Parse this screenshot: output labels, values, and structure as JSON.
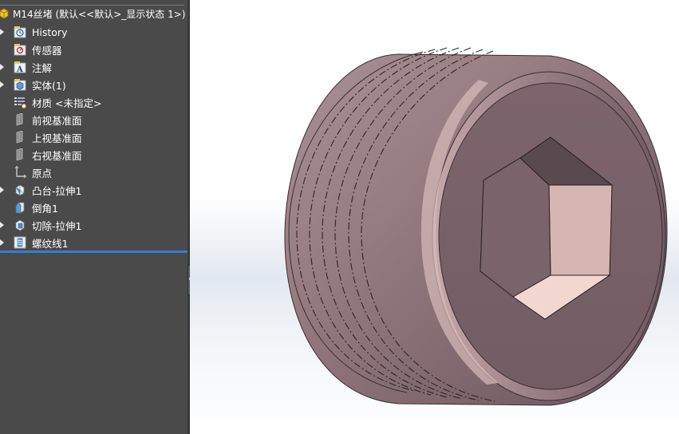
{
  "tree": {
    "root_label": "M14丝堵 (默认<<默认>_显示状态 1>)",
    "items": [
      {
        "label": "History",
        "icon": "history-icon",
        "expandable": true
      },
      {
        "label": "传感器",
        "icon": "sensor-icon",
        "expandable": false
      },
      {
        "label": "注解",
        "icon": "annotation-icon",
        "expandable": true
      },
      {
        "label": "实体(1)",
        "icon": "solid-body-icon",
        "expandable": true
      },
      {
        "label": "材质 <未指定>",
        "icon": "material-icon",
        "expandable": false
      },
      {
        "label": "前视基准面",
        "icon": "plane-icon",
        "expandable": false
      },
      {
        "label": "上视基准面",
        "icon": "plane-icon",
        "expandable": false
      },
      {
        "label": "右视基准面",
        "icon": "plane-icon",
        "expandable": false
      },
      {
        "label": "原点",
        "icon": "origin-icon",
        "expandable": false
      },
      {
        "label": "凸台-拉伸1",
        "icon": "boss-extrude-icon",
        "expandable": true
      },
      {
        "label": "倒角1",
        "icon": "chamfer-icon",
        "expandable": false
      },
      {
        "label": "切除-拉伸1",
        "icon": "cut-extrude-icon",
        "expandable": true
      },
      {
        "label": "螺纹线1",
        "icon": "thread-icon",
        "expandable": true
      }
    ]
  },
  "model": {
    "name": "M14丝堵",
    "body_color": "#8f7378",
    "face_color": "#7a6169",
    "accent_highlight": "#f2d6d0"
  },
  "colors": {
    "tree_bg": "#4a4a4a",
    "selection_bar": "#2f7fd0"
  }
}
